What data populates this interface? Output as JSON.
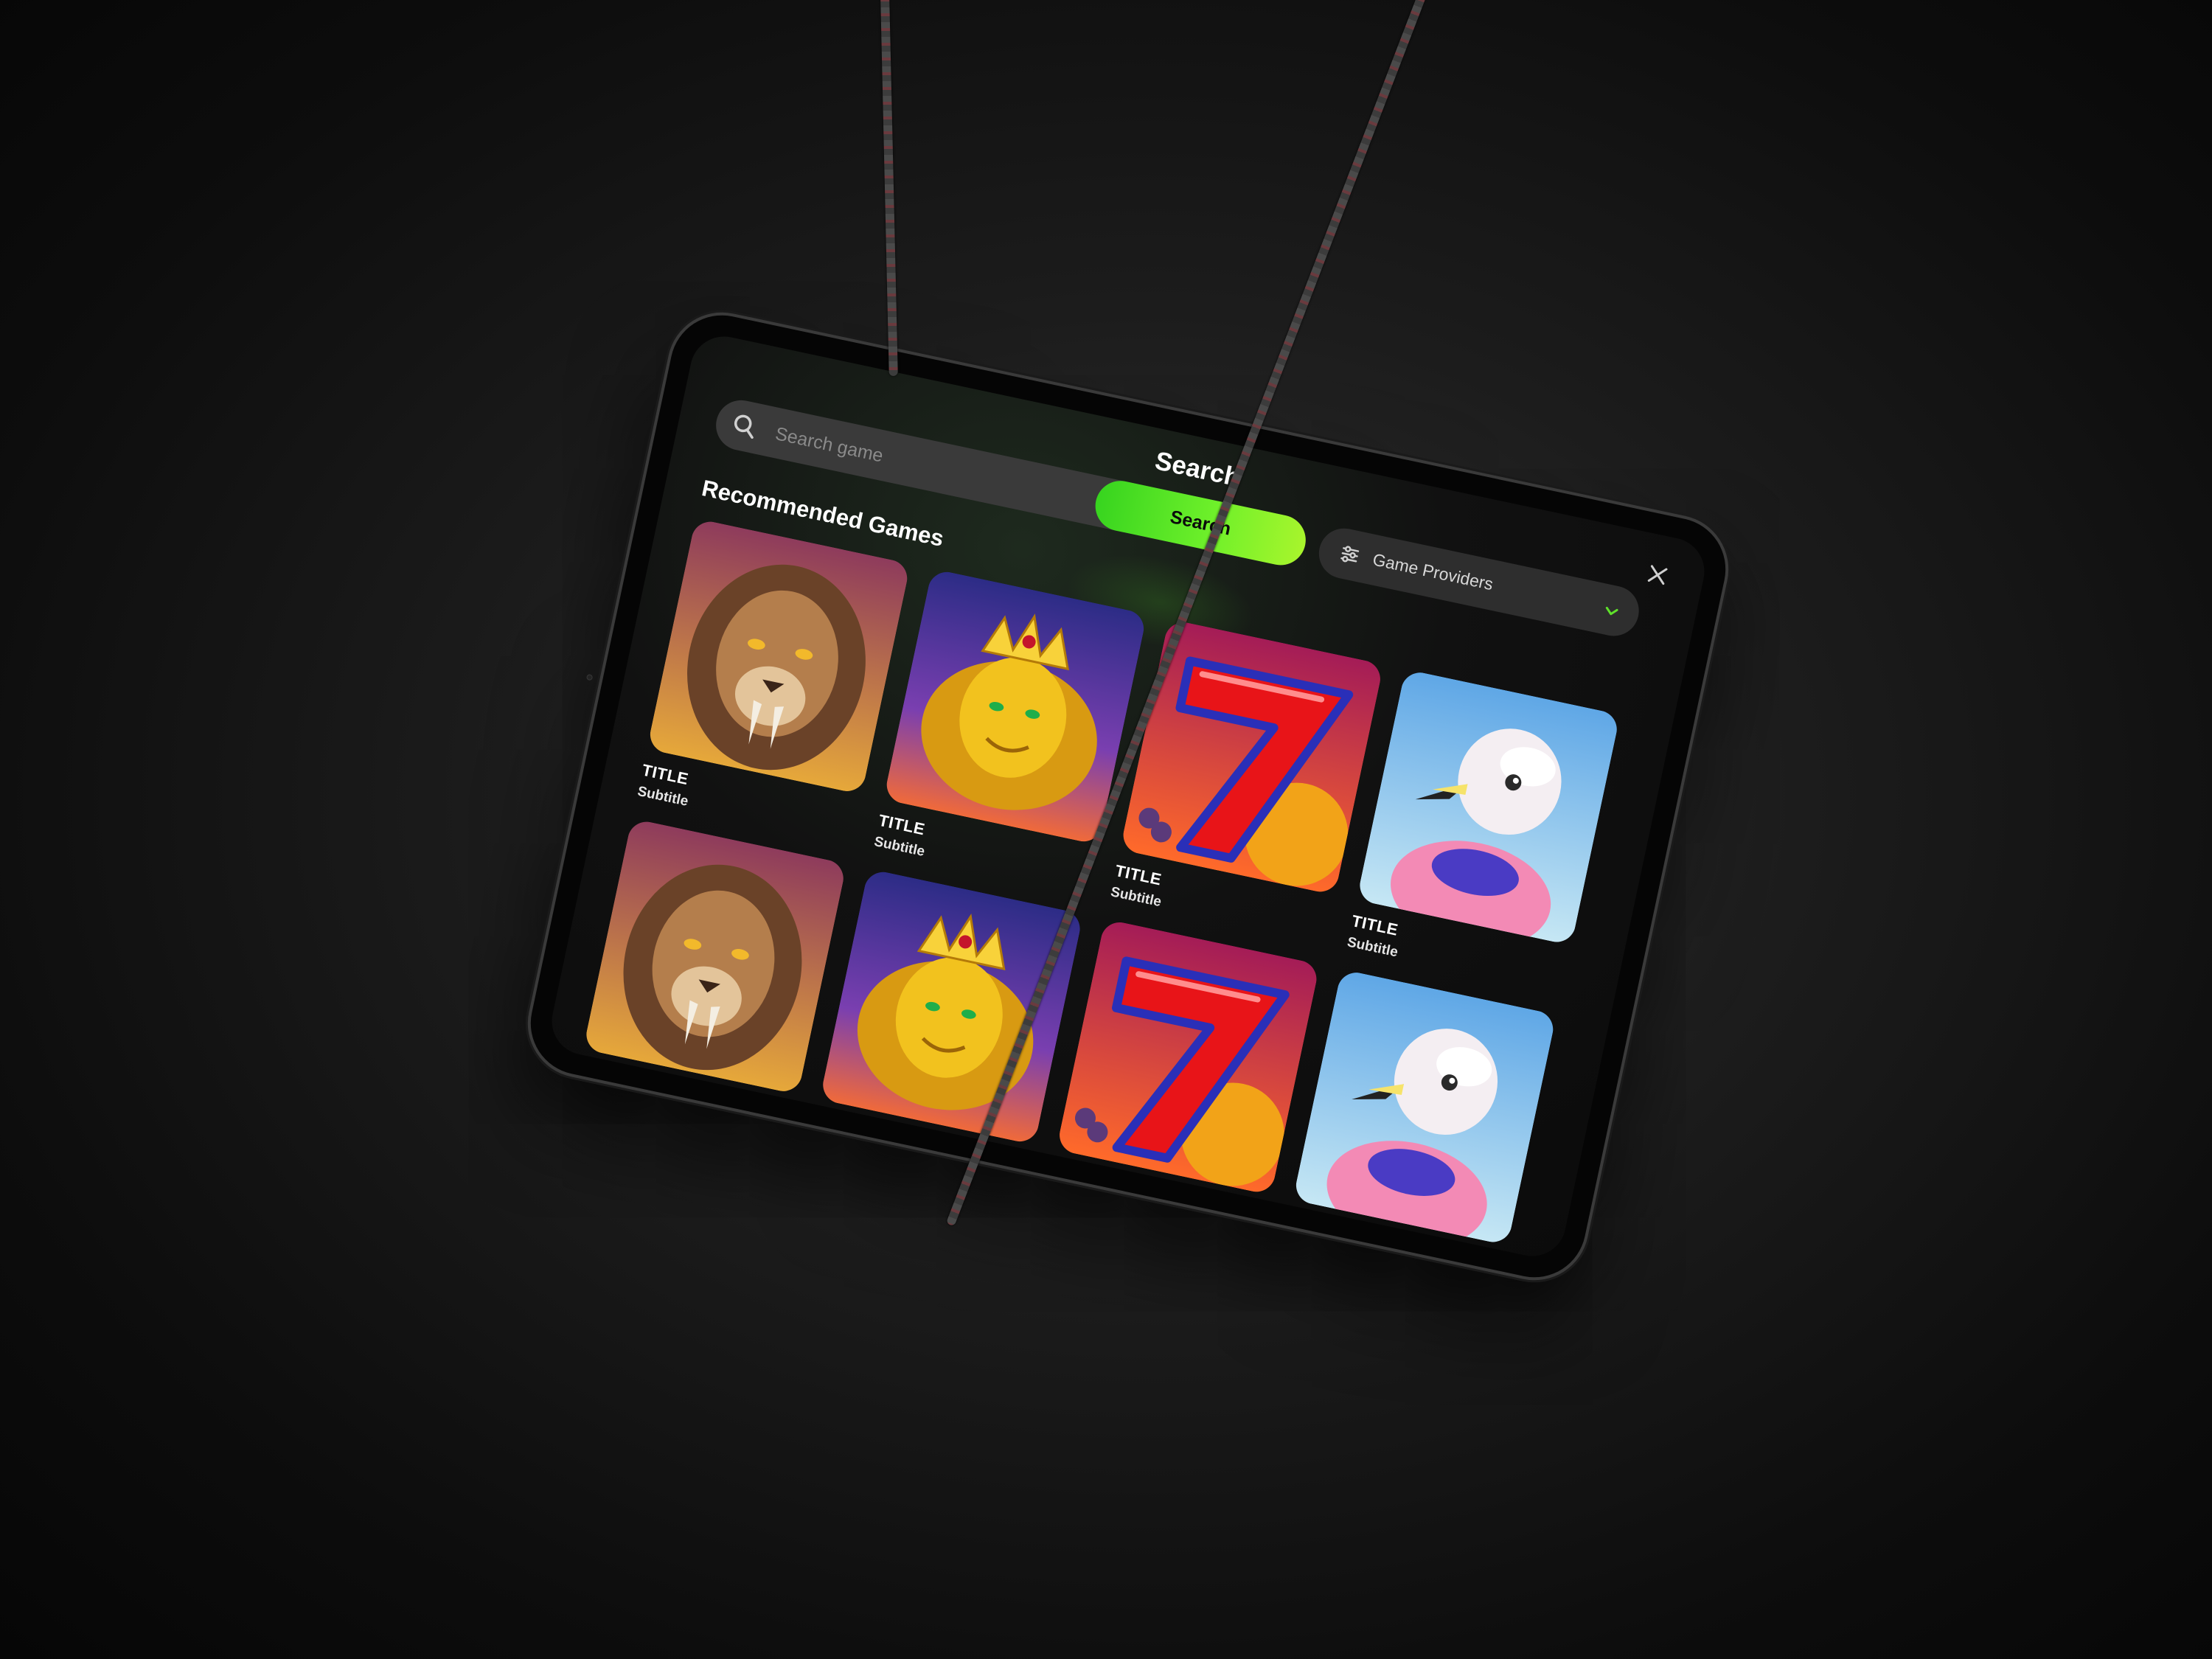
{
  "header": {
    "title": "Search",
    "close_icon": "close-icon"
  },
  "search": {
    "placeholder": "Search game",
    "button_label": "Search",
    "icon": "search-icon"
  },
  "filters": {
    "providers_label": "Game Providers",
    "icon": "filter-sliders-icon",
    "chevron": "chevron-down-icon"
  },
  "section": {
    "title": "Recommended Games"
  },
  "games": [
    {
      "art": "lion",
      "title": "TITLE",
      "subtitle": "Subtitle"
    },
    {
      "art": "king",
      "title": "TITLE",
      "subtitle": "Subtitle"
    },
    {
      "art": "seven",
      "title": "TITLE",
      "subtitle": "Subtitle"
    },
    {
      "art": "flamingo",
      "title": "TITLE",
      "subtitle": "Subtitle"
    },
    {
      "art": "lion",
      "title": "",
      "subtitle": ""
    },
    {
      "art": "king",
      "title": "",
      "subtitle": ""
    },
    {
      "art": "seven",
      "title": "",
      "subtitle": ""
    },
    {
      "art": "flamingo",
      "title": "",
      "subtitle": ""
    }
  ],
  "colors": {
    "accent_green": "#37d41f",
    "accent_lime": "#a8f52c",
    "background": "#0b0b0b",
    "field": "#3a3a3a"
  }
}
